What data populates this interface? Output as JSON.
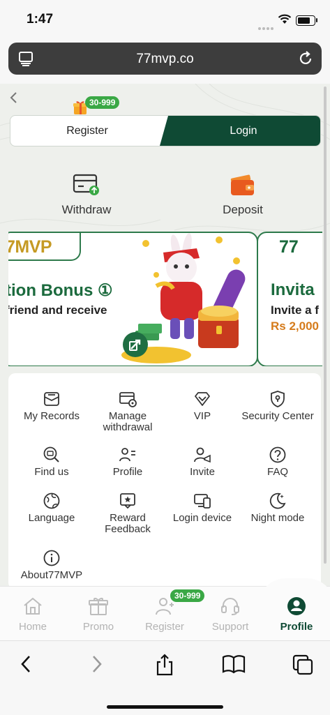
{
  "status_bar": {
    "time": "1:47"
  },
  "browser": {
    "domain": "77mvp.co"
  },
  "auth": {
    "badge": "30-999",
    "register_label": "Register",
    "login_label": "Login"
  },
  "quick_actions": [
    {
      "label": "Withdraw",
      "icon": "withdraw-card-icon"
    },
    {
      "label": "Deposit",
      "icon": "wallet-icon"
    }
  ],
  "banner": {
    "card1": {
      "brand": "7MVP",
      "title": "tion Bonus ①",
      "subtitle": "friend and receive"
    },
    "card2": {
      "brand": "77",
      "title": "Invita",
      "subtitle": "Invite a f",
      "amount": "Rs 2,000"
    }
  },
  "menu": {
    "items": [
      {
        "label": "My Records",
        "icon": "records-icon"
      },
      {
        "label": "Manage withdrawal",
        "icon": "manage-withdrawal-icon"
      },
      {
        "label": "VIP",
        "icon": "vip-diamond-icon"
      },
      {
        "label": "Security Center",
        "icon": "security-shield-icon"
      },
      {
        "label": "Find us",
        "icon": "find-us-icon"
      },
      {
        "label": "Profile",
        "icon": "profile-card-icon"
      },
      {
        "label": "Invite",
        "icon": "invite-icon"
      },
      {
        "label": "FAQ",
        "icon": "faq-icon"
      },
      {
        "label": "Language",
        "icon": "language-globe-icon"
      },
      {
        "label": "Reward Feedback",
        "icon": "reward-feedback-icon"
      },
      {
        "label": "Login device",
        "icon": "login-device-icon"
      },
      {
        "label": "Night mode",
        "icon": "night-mode-icon"
      },
      {
        "label": "About77MVP",
        "icon": "about-info-icon"
      }
    ]
  },
  "tabbar": {
    "register_badge": "30-999",
    "tabs": [
      {
        "label": "Home",
        "active": false
      },
      {
        "label": "Promo",
        "active": false
      },
      {
        "label": "Register",
        "active": false
      },
      {
        "label": "Support",
        "active": false
      },
      {
        "label": "Profile",
        "active": true
      }
    ]
  },
  "colors": {
    "primary": "#0f4a34",
    "badge": "#3aa845",
    "accent_gold": "#c59a24",
    "muted": "#b3b3b3"
  }
}
